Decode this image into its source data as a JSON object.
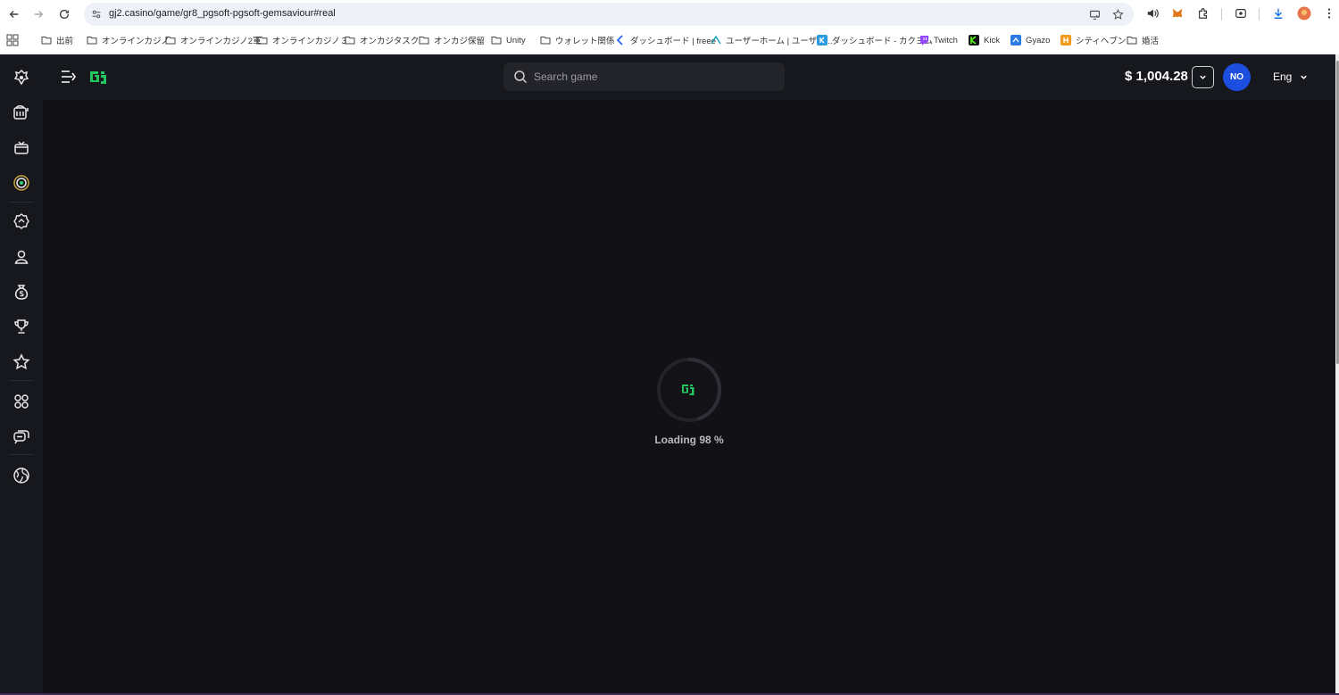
{
  "browser": {
    "url": "gj2.casino/game/gr8_pgsoft-pgsoft-gemsaviour#real",
    "bookmarks": [
      "出前",
      "オンラインカジノ",
      "オンラインカジノ2軍",
      "オンラインカジノ３",
      "オンカジタスク",
      "オンカジ保留",
      "Unity",
      "ウォレット関係",
      "ダッシュボード | freee",
      "ユーザーホーム | ユーザベ...",
      "ダッシュボード - カクヨム",
      "Twitch",
      "Kick",
      "Gyazo",
      "シティヘブン",
      "婚活"
    ]
  },
  "header": {
    "search_placeholder": "Search game",
    "balance": "$ 1,004.28",
    "avatar_initials": "NO",
    "language": "Eng"
  },
  "loader": {
    "text": "Loading 98 %",
    "progress": 0.98,
    "logo_text": "Gj"
  },
  "colors": {
    "brand_green": "#22c55e",
    "avatar_blue": "#1c4fe0",
    "background": "#111116",
    "panel": "#17181d"
  },
  "sidebar": {
    "icons": [
      "casino-logo-icon",
      "slots-icon",
      "gift-box-icon",
      "live-casino-icon",
      "sports-badge-icon",
      "profile-icon",
      "money-bag-icon",
      "trophy-icon",
      "star-icon",
      "apps-grid-icon",
      "chat-icon",
      "globe-icon"
    ]
  }
}
